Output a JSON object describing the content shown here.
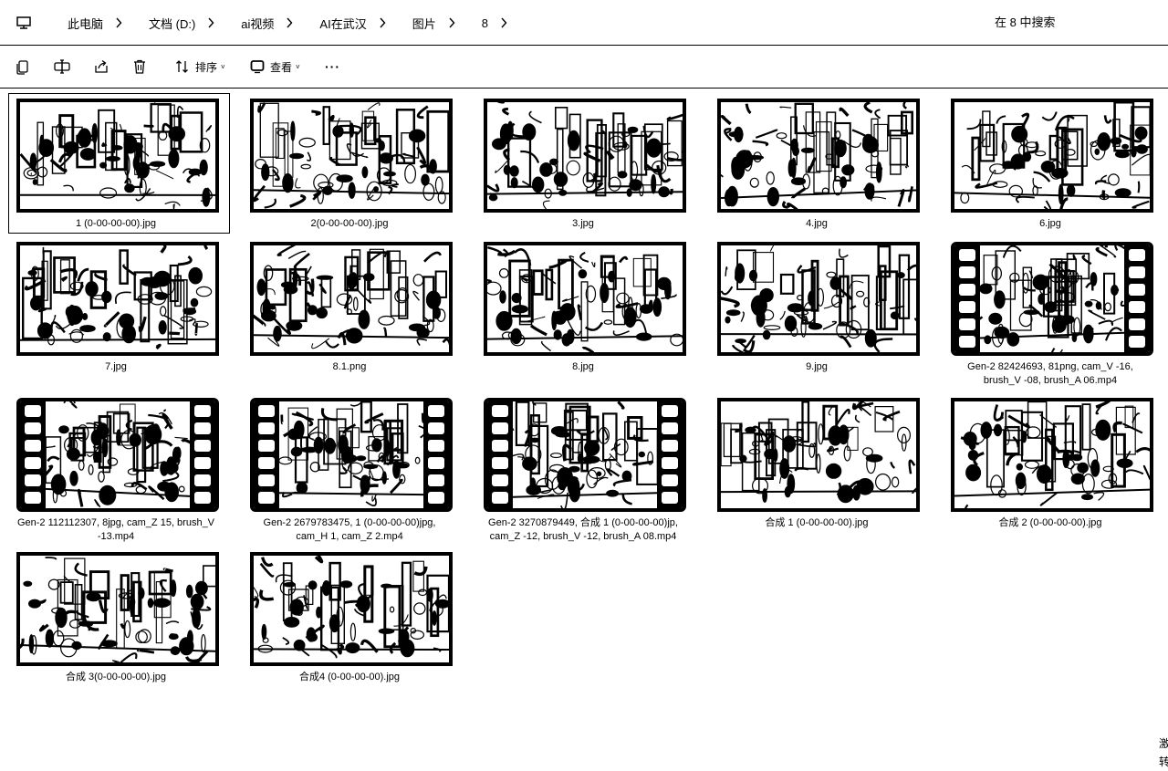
{
  "breadcrumb": {
    "items": [
      "此电脑",
      "文档 (D:)",
      "ai视频",
      "AI在武汉",
      "图片",
      "8"
    ]
  },
  "search": {
    "placeholder": "在 8 中搜索"
  },
  "toolbar": {
    "sort_label": "排序",
    "view_label": "查看",
    "more_label": "···"
  },
  "files": [
    {
      "name": "1 (0-00-00-00).jpg",
      "type": "image",
      "selected": true
    },
    {
      "name": "2(0-00-00-00).jpg",
      "type": "image"
    },
    {
      "name": "3.jpg",
      "type": "image"
    },
    {
      "name": "4.jpg",
      "type": "image"
    },
    {
      "name": "6.jpg",
      "type": "image"
    },
    {
      "name": "7.jpg",
      "type": "image"
    },
    {
      "name": "8.1.png",
      "type": "image"
    },
    {
      "name": "8.jpg",
      "type": "image"
    },
    {
      "name": "9.jpg",
      "type": "image"
    },
    {
      "name": "Gen-2 82424693, 81png, cam_V -16, brush_V -08, brush_A 06.mp4",
      "line1": "Gen-2 82424693, 81png, cam_V -16,",
      "line2": "brush_V -08, brush_A 06.mp4",
      "type": "video"
    },
    {
      "name": "Gen-2 112112307, 8jpg, cam_Z 15, brush_V -13.mp4",
      "line1": "Gen-2 112112307, 8jpg, cam_Z 15, brush_V",
      "line2": "-13.mp4",
      "type": "video"
    },
    {
      "name": "Gen-2 2679783475, 1 (0-00-00-00)jpg, cam_H 1, cam_Z 2.mp4",
      "line1": "Gen-2 2679783475, 1 (0-00-00-00)jpg,",
      "line2": "cam_H 1, cam_Z 2.mp4",
      "type": "video"
    },
    {
      "name": "Gen-2 3270879449, 合成 1 (0-00-00-00)jp, cam_Z -12, brush_V -12, brush_A 08.mp4",
      "line1": "Gen-2 3270879449, 合成 1 (0-00-00-00)jp,",
      "line2": "cam_Z -12, brush_V -12, brush_A 08.mp4",
      "type": "video"
    },
    {
      "name": "合成 1 (0-00-00-00).jpg",
      "type": "image"
    },
    {
      "name": "合成 2 (0-00-00-00).jpg",
      "type": "image"
    },
    {
      "name": "合成 3(0-00-00-00).jpg",
      "type": "image"
    },
    {
      "name": "合成4 (0-00-00-00).jpg",
      "type": "image"
    }
  ],
  "side_text": "激\n转"
}
